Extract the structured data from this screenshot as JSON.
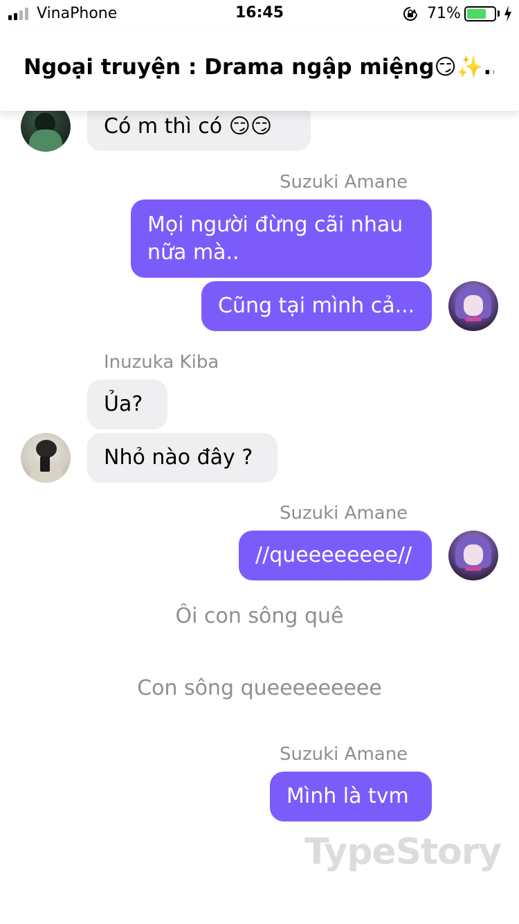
{
  "status_bar": {
    "carrier": "VinaPhone",
    "time": "16:45",
    "battery_percent": "71%",
    "battery_level": 0.71,
    "signal_bars_active": 2,
    "signal_bars_total": 4
  },
  "header": {
    "title": "Ngoại truyện : Drama ngập miệng😏✨..."
  },
  "messages": [
    {
      "type": "incoming",
      "text": "Có m thì có 😏😏"
    },
    {
      "type": "sender",
      "name": "Suzuki Amane"
    },
    {
      "type": "outgoing",
      "text": "Mọi người đừng cãi nhau nữa mà.."
    },
    {
      "type": "outgoing",
      "text": "Cũng tại mình cả..."
    },
    {
      "type": "sender",
      "name": "Inuzuka Kiba"
    },
    {
      "type": "incoming",
      "text": "Ủa?"
    },
    {
      "type": "incoming",
      "text": "Nhỏ nào đây ?"
    },
    {
      "type": "sender",
      "name": "Suzuki Amane"
    },
    {
      "type": "outgoing",
      "text": "//queeeeeeee//"
    },
    {
      "type": "narration",
      "text": "Ôi con sông quê"
    },
    {
      "type": "narration",
      "text": "Con sông queeeeeeeee"
    },
    {
      "type": "sender",
      "name": "Suzuki Amane"
    },
    {
      "type": "outgoing",
      "text": "Mình là tvm"
    }
  ],
  "watermark": "TypeStory",
  "colors": {
    "outgoing_bubble": "#7b5cfb",
    "incoming_bubble": "#efeff1",
    "sender_name": "#8e8e93",
    "battery_fill": "#4cd964"
  },
  "icons": [
    "signal-icon",
    "orientation-lock-icon",
    "battery-icon",
    "charging-bolt-icon"
  ]
}
